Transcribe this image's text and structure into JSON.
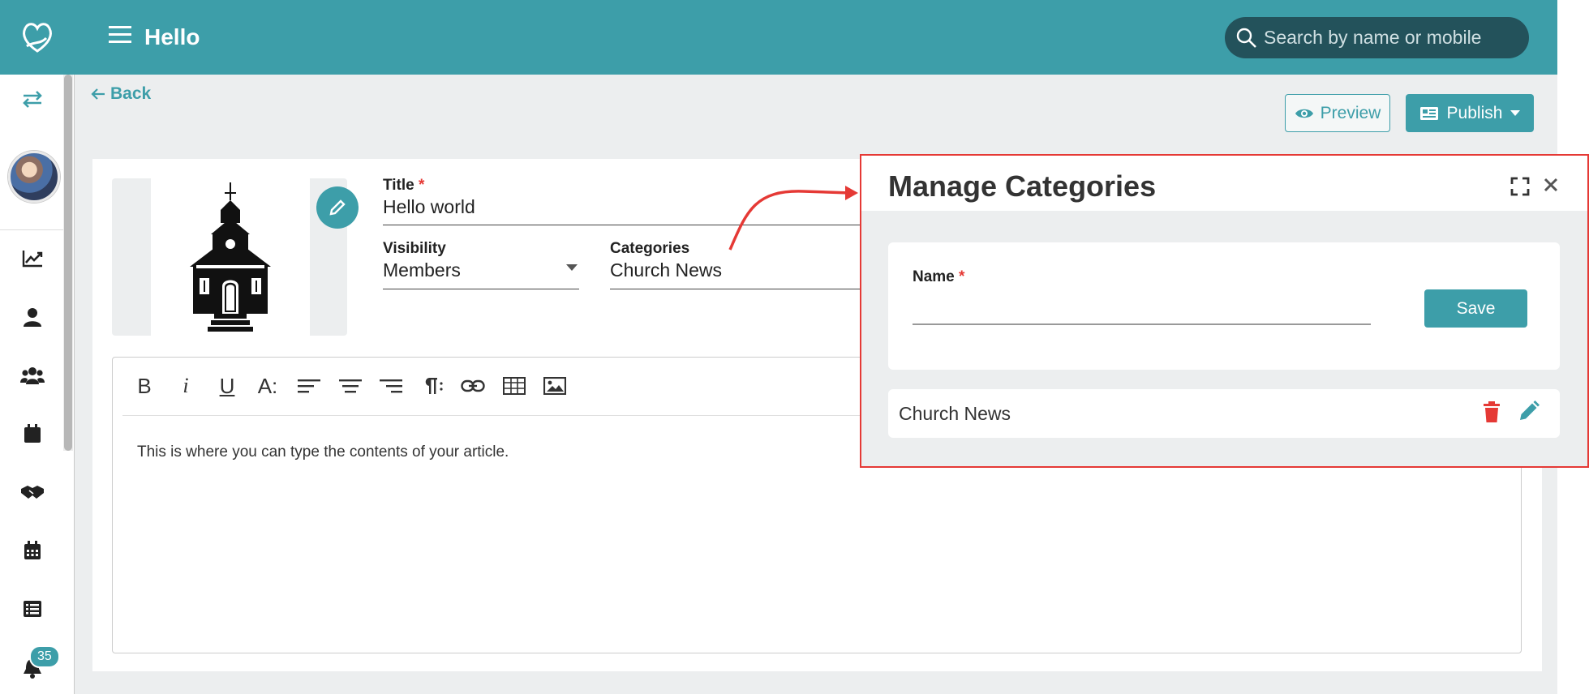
{
  "app": {
    "title": "Hello"
  },
  "search": {
    "placeholder": "Search by name or mobile"
  },
  "sidebar": {
    "notification_count": "35"
  },
  "page": {
    "back_label": "Back",
    "preview_label": "Preview",
    "publish_label": "Publish"
  },
  "article": {
    "title_label": "Title",
    "title_value": "Hello world",
    "visibility_label": "Visibility",
    "visibility_value": "Members",
    "categories_label": "Categories",
    "categories_value": "Church News",
    "required_mark": "*",
    "body_text": "This is where you can type the contents of your article."
  },
  "toolbar": {
    "bold": "B",
    "italic": "i",
    "underline": "U",
    "font_size": "A:"
  },
  "categories_panel": {
    "title": "Manage Categories",
    "name_label": "Name",
    "required_mark": "*",
    "save_label": "Save",
    "items": [
      {
        "label": "Church News"
      }
    ]
  },
  "colors": {
    "accent": "#3d9ea9",
    "danger": "#e53935",
    "search_bg": "#23525b"
  }
}
